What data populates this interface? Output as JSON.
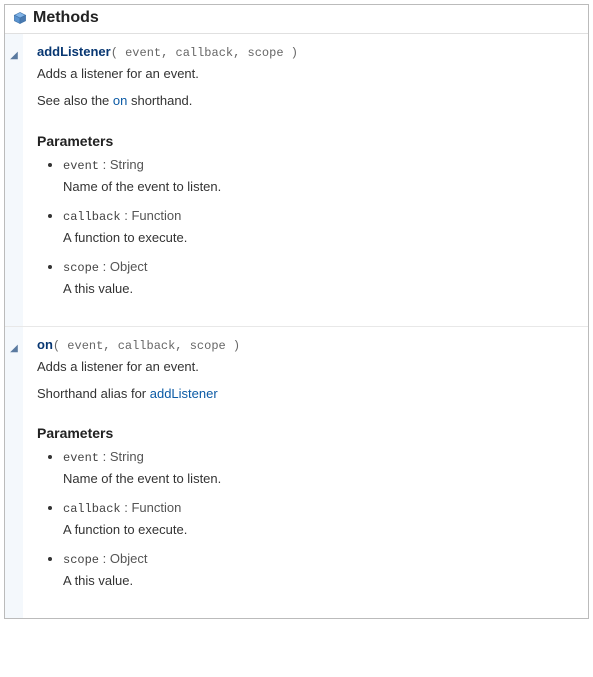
{
  "section_title": "Methods",
  "methods": [
    {
      "name": "addListener",
      "signature": "( event, callback, scope )",
      "summary": "Adds a listener for an event.",
      "see_also_pre": "See also the ",
      "see_also_link": "on",
      "see_also_post": " shorthand.",
      "params_heading": "Parameters",
      "params": [
        {
          "name": "event",
          "type": "String",
          "desc": "Name of the event to listen."
        },
        {
          "name": "callback",
          "type": "Function",
          "desc": "A function to execute."
        },
        {
          "name": "scope",
          "type": "Object",
          "desc": "A this value."
        }
      ]
    },
    {
      "name": "on",
      "signature": "( event, callback, scope )",
      "summary": "Adds a listener for an event.",
      "see_also_pre": "Shorthand alias for ",
      "see_also_link": "addListener",
      "see_also_post": "",
      "params_heading": "Parameters",
      "params": [
        {
          "name": "event",
          "type": "String",
          "desc": "Name of the event to listen."
        },
        {
          "name": "callback",
          "type": "Function",
          "desc": "A function to execute."
        },
        {
          "name": "scope",
          "type": "Object",
          "desc": "A this value."
        }
      ]
    }
  ]
}
